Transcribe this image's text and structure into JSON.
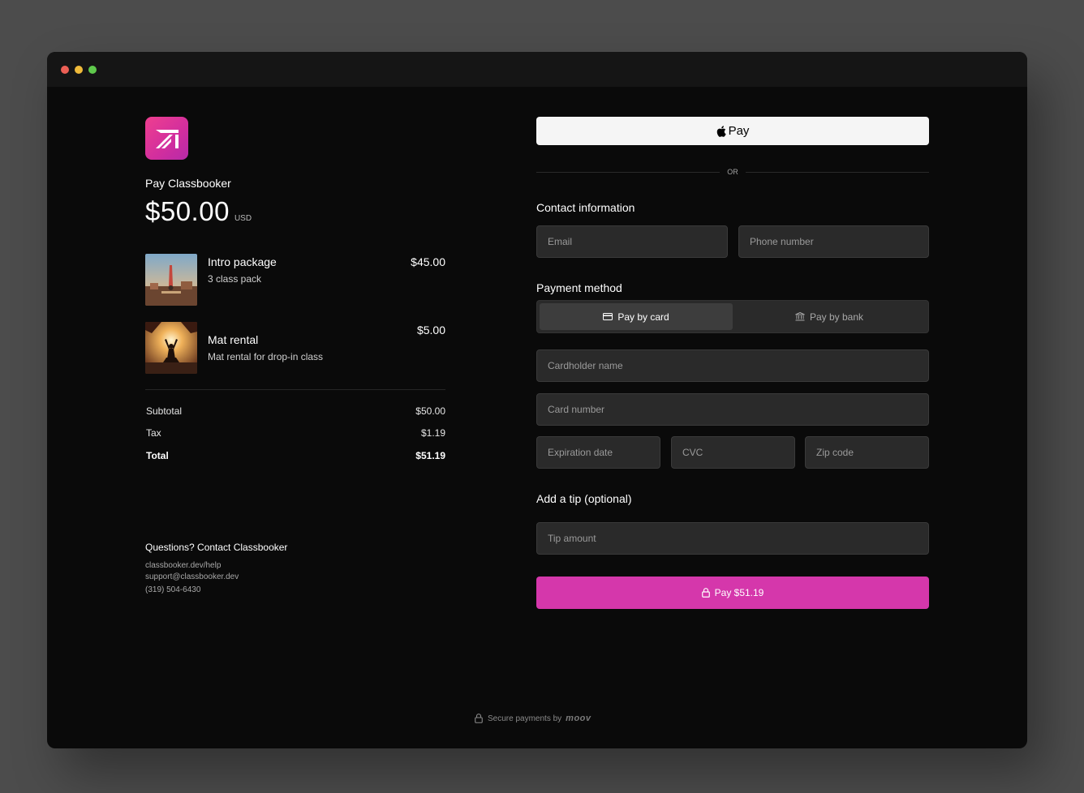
{
  "merchant": {
    "pay_label": "Pay Classbooker",
    "amount": "$50.00",
    "currency": "USD"
  },
  "items": [
    {
      "name": "Intro package",
      "description": "3 class pack",
      "price": "$45.00"
    },
    {
      "name": "Mat rental",
      "description": "Mat rental for drop-in class",
      "price": "$5.00"
    }
  ],
  "summary": {
    "subtotal_label": "Subtotal",
    "subtotal": "$50.00",
    "tax_label": "Tax",
    "tax": "$1.19",
    "total_label": "Total",
    "total": "$51.19"
  },
  "contact": {
    "title": "Questions? Contact Classbooker",
    "help_url": "classbooker.dev/help",
    "email": "support@classbooker.dev",
    "phone": "(319) 504-6430"
  },
  "checkout": {
    "apple_pay_label": "Pay",
    "or_label": "OR",
    "contact_title": "Contact information",
    "email_placeholder": "Email",
    "phone_placeholder": "Phone number",
    "payment_title": "Payment method",
    "pay_by_card": "Pay by card",
    "pay_by_bank": "Pay by bank",
    "selected_method": "Pay by card",
    "cardholder_placeholder": "Cardholder name",
    "card_number_placeholder": "Card number",
    "expiration_placeholder": "Expiration date",
    "cvc_placeholder": "CVC",
    "zip_placeholder": "Zip code",
    "tip_title": "Add a tip (optional)",
    "tip_placeholder": "Tip amount",
    "pay_button": "Pay $51.19"
  },
  "footer": {
    "secure_text": "Secure payments by",
    "brand": "moov"
  },
  "colors": {
    "accent": "#d537ab",
    "background": "#0a0a0a",
    "field": "#2a2a2a"
  }
}
